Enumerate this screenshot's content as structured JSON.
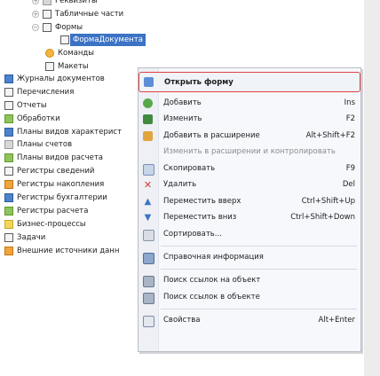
{
  "tree": {
    "items": [
      {
        "label": "Реквизиты"
      },
      {
        "label": "Табличные части"
      },
      {
        "label": "Формы"
      },
      {
        "label": "ФормаДокумента"
      },
      {
        "label": "Команды"
      },
      {
        "label": "Макеты"
      },
      {
        "label": "Журналы документов"
      },
      {
        "label": "Перечисления"
      },
      {
        "label": "Отчеты"
      },
      {
        "label": "Обработки"
      },
      {
        "label": "Планы видов характерист"
      },
      {
        "label": "Планы счетов"
      },
      {
        "label": "Планы видов расчета"
      },
      {
        "label": "Регистры сведений"
      },
      {
        "label": "Регистры накопления"
      },
      {
        "label": "Регистры бухгалтерии"
      },
      {
        "label": "Регистры расчета"
      },
      {
        "label": "Бизнес-процессы"
      },
      {
        "label": "Задачи"
      },
      {
        "label": "Внешние источники данн"
      }
    ]
  },
  "menu": {
    "items": [
      {
        "label": "Открыть форму",
        "shortcut": ""
      },
      {
        "label": "Добавить",
        "shortcut": "Ins"
      },
      {
        "label": "Изменить",
        "shortcut": "F2"
      },
      {
        "label": "Добавить в расширение",
        "shortcut": "Alt+Shift+F2"
      },
      {
        "label": "Изменить в расширении и контролировать",
        "shortcut": ""
      },
      {
        "label": "Скопировать",
        "shortcut": "F9"
      },
      {
        "label": "Удалить",
        "shortcut": "Del"
      },
      {
        "label": "Переместить вверх",
        "shortcut": "Ctrl+Shift+Up"
      },
      {
        "label": "Переместить вниз",
        "shortcut": "Ctrl+Shift+Down"
      },
      {
        "label": "Сортировать...",
        "shortcut": ""
      },
      {
        "label": "Справочная информация",
        "shortcut": ""
      },
      {
        "label": "Поиск ссылок на объект",
        "shortcut": ""
      },
      {
        "label": "Поиск ссылок в объекте",
        "shortcut": ""
      },
      {
        "label": "Свойства",
        "shortcut": "Alt+Enter"
      }
    ]
  },
  "colors": {
    "selection": "#3c73c4",
    "menu_highlight_border": "#e04242"
  }
}
